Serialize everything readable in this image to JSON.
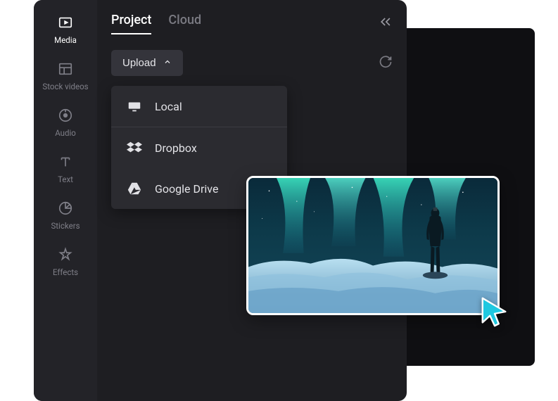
{
  "sidebar": {
    "items": [
      {
        "label": "Media"
      },
      {
        "label": "Stock videos"
      },
      {
        "label": "Audio"
      },
      {
        "label": "Text"
      },
      {
        "label": "Stickers"
      },
      {
        "label": "Effects"
      }
    ]
  },
  "tabs": {
    "project": "Project",
    "cloud": "Cloud"
  },
  "upload": {
    "label": "Upload"
  },
  "dropdown": {
    "local": "Local",
    "dropbox": "Dropbox",
    "gdrive": "Google Drive"
  }
}
